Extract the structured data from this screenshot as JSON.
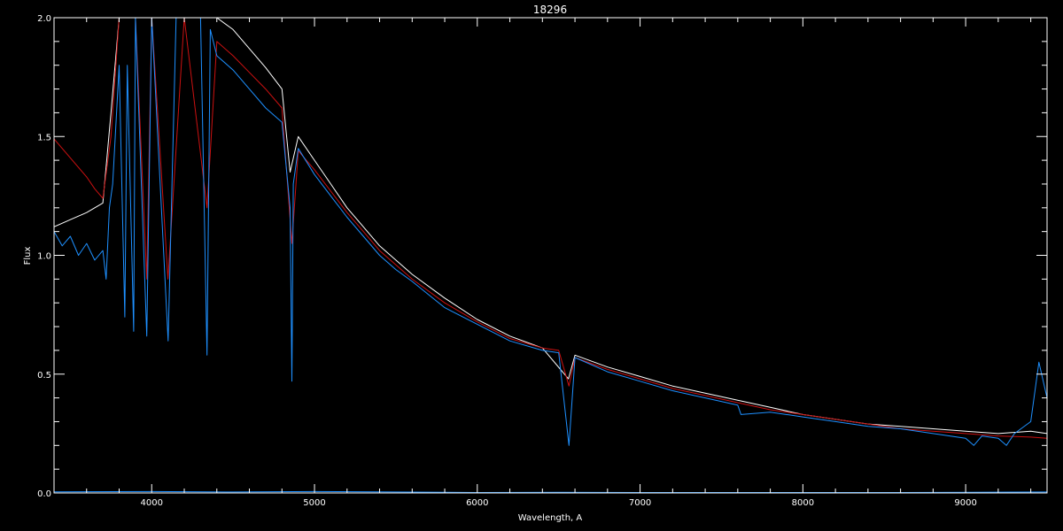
{
  "chart_data": {
    "type": "line",
    "title": "18296",
    "xlabel": "Wavelength, A",
    "ylabel": "Flux",
    "xlim": [
      3400,
      9500
    ],
    "ylim": [
      0.0,
      2.0
    ],
    "x_ticks": [
      4000,
      5000,
      6000,
      7000,
      8000,
      9000
    ],
    "x_tick_labels": [
      "4000",
      "5000",
      "6000",
      "7000",
      "8000",
      "9000"
    ],
    "y_ticks": [
      0.0,
      0.5,
      1.0,
      1.5,
      2.0
    ],
    "y_tick_labels": [
      "0.0",
      "0.5",
      "1.0",
      "1.5",
      "2.0"
    ],
    "grid": false,
    "colors": {
      "background": "#000000",
      "axes": "#ffffff",
      "observed": "#ffffff",
      "model": "#cc1111",
      "spectrum": "#1e90ff"
    },
    "series": [
      {
        "color": "#ffffff",
        "x": [
          3400,
          3500,
          3600,
          3700,
          3750,
          3800,
          3900,
          4000,
          4100,
          4200,
          4300,
          4400,
          4500,
          4600,
          4700,
          4800,
          4850,
          4900,
          5000,
          5100,
          5200,
          5300,
          5400,
          5500,
          5600,
          5800,
          6000,
          6200,
          6400,
          6560,
          6600,
          6800,
          7000,
          7200,
          7400,
          7600,
          7800,
          8000,
          8200,
          8400,
          8600,
          8800,
          9000,
          9200,
          9400,
          9500
        ],
        "y": [
          1.12,
          1.15,
          1.18,
          1.22,
          1.6,
          2.0,
          2.0,
          2.0,
          2.0,
          2.0,
          2.0,
          2.0,
          1.95,
          1.87,
          1.79,
          1.7,
          1.35,
          1.5,
          1.4,
          1.3,
          1.2,
          1.12,
          1.04,
          0.98,
          0.92,
          0.82,
          0.73,
          0.66,
          0.61,
          0.48,
          0.58,
          0.53,
          0.49,
          0.45,
          0.42,
          0.39,
          0.36,
          0.33,
          0.31,
          0.29,
          0.28,
          0.27,
          0.26,
          0.25,
          0.26,
          0.25
        ]
      },
      {
        "color": "#cc1111",
        "x": [
          3400,
          3450,
          3500,
          3550,
          3600,
          3650,
          3700,
          3750,
          3800,
          3900,
          3970,
          4000,
          4100,
          4200,
          4340,
          4400,
          4500,
          4600,
          4700,
          4800,
          4861,
          4900,
          5000,
          5100,
          5200,
          5300,
          5400,
          5500,
          5600,
          5800,
          6000,
          6200,
          6400,
          6500,
          6563,
          6600,
          6800,
          7000,
          7200,
          7400,
          7600,
          7800,
          8000,
          8200,
          8400,
          8600,
          8800,
          9000,
          9200,
          9400,
          9500
        ],
        "y": [
          1.49,
          1.45,
          1.41,
          1.37,
          1.33,
          1.28,
          1.24,
          1.5,
          2.0,
          2.0,
          0.9,
          2.0,
          0.9,
          2.0,
          1.2,
          1.9,
          1.84,
          1.77,
          1.7,
          1.62,
          1.05,
          1.44,
          1.36,
          1.27,
          1.18,
          1.1,
          1.02,
          0.96,
          0.9,
          0.8,
          0.72,
          0.65,
          0.61,
          0.6,
          0.45,
          0.57,
          0.52,
          0.48,
          0.44,
          0.41,
          0.38,
          0.35,
          0.33,
          0.31,
          0.29,
          0.27,
          0.26,
          0.25,
          0.24,
          0.235,
          0.23
        ]
      },
      {
        "color": "#1e90ff",
        "x": [
          3400,
          3450,
          3500,
          3550,
          3600,
          3650,
          3700,
          3720,
          3740,
          3760,
          3800,
          3835,
          3850,
          3889,
          3900,
          3970,
          4000,
          4101,
          4150,
          4200,
          4300,
          4340,
          4360,
          4400,
          4500,
          4600,
          4700,
          4800,
          4850,
          4861,
          4870,
          4900,
          5000,
          5100,
          5200,
          5300,
          5400,
          5500,
          5600,
          5800,
          6000,
          6200,
          6400,
          6500,
          6563,
          6600,
          6800,
          7000,
          7200,
          7400,
          7600,
          7620,
          7800,
          8000,
          8200,
          8400,
          8600,
          8800,
          9000,
          9050,
          9100,
          9200,
          9250,
          9300,
          9400,
          9450,
          9500
        ],
        "y": [
          1.1,
          1.04,
          1.08,
          1.0,
          1.05,
          0.98,
          1.02,
          0.9,
          1.2,
          1.3,
          1.8,
          0.74,
          1.8,
          0.68,
          2.0,
          0.66,
          2.0,
          0.64,
          2.0,
          2.0,
          2.0,
          0.58,
          1.95,
          1.84,
          1.78,
          1.7,
          1.62,
          1.56,
          1.2,
          0.47,
          1.3,
          1.45,
          1.34,
          1.25,
          1.16,
          1.08,
          1.0,
          0.94,
          0.89,
          0.78,
          0.71,
          0.64,
          0.6,
          0.59,
          0.2,
          0.57,
          0.51,
          0.47,
          0.43,
          0.4,
          0.37,
          0.33,
          0.34,
          0.32,
          0.3,
          0.28,
          0.27,
          0.25,
          0.23,
          0.2,
          0.24,
          0.23,
          0.2,
          0.25,
          0.3,
          0.55,
          0.4
        ]
      },
      {
        "color": "#1e90ff",
        "x": [
          3400,
          4000,
          4500,
          5000,
          5500,
          6000,
          6500,
          7000,
          7500,
          8000,
          8500,
          9000,
          9500
        ],
        "y": [
          0.005,
          0.006,
          0.004,
          0.006,
          0.004,
          0.002,
          0.003,
          0.002,
          0.002,
          0.002,
          0.002,
          0.003,
          0.004
        ]
      }
    ]
  }
}
